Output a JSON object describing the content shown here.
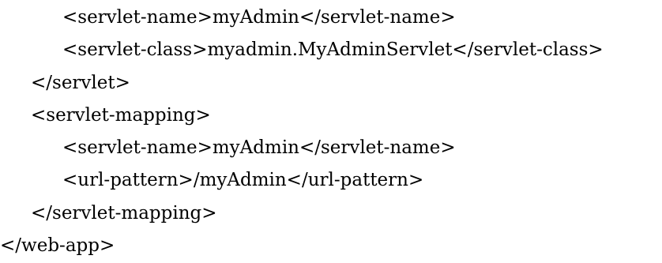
{
  "code": {
    "lines": [
      "<servlet-name>myAdmin</servlet-name>",
      "<servlet-class>myadmin.MyAdminServlet</servlet-class>",
      "</servlet>",
      "<servlet-mapping>",
      "<servlet-name>myAdmin</servlet-name>",
      "<url-pattern>/myAdmin</url-pattern>",
      "</servlet-mapping>",
      "</web-app>"
    ]
  }
}
